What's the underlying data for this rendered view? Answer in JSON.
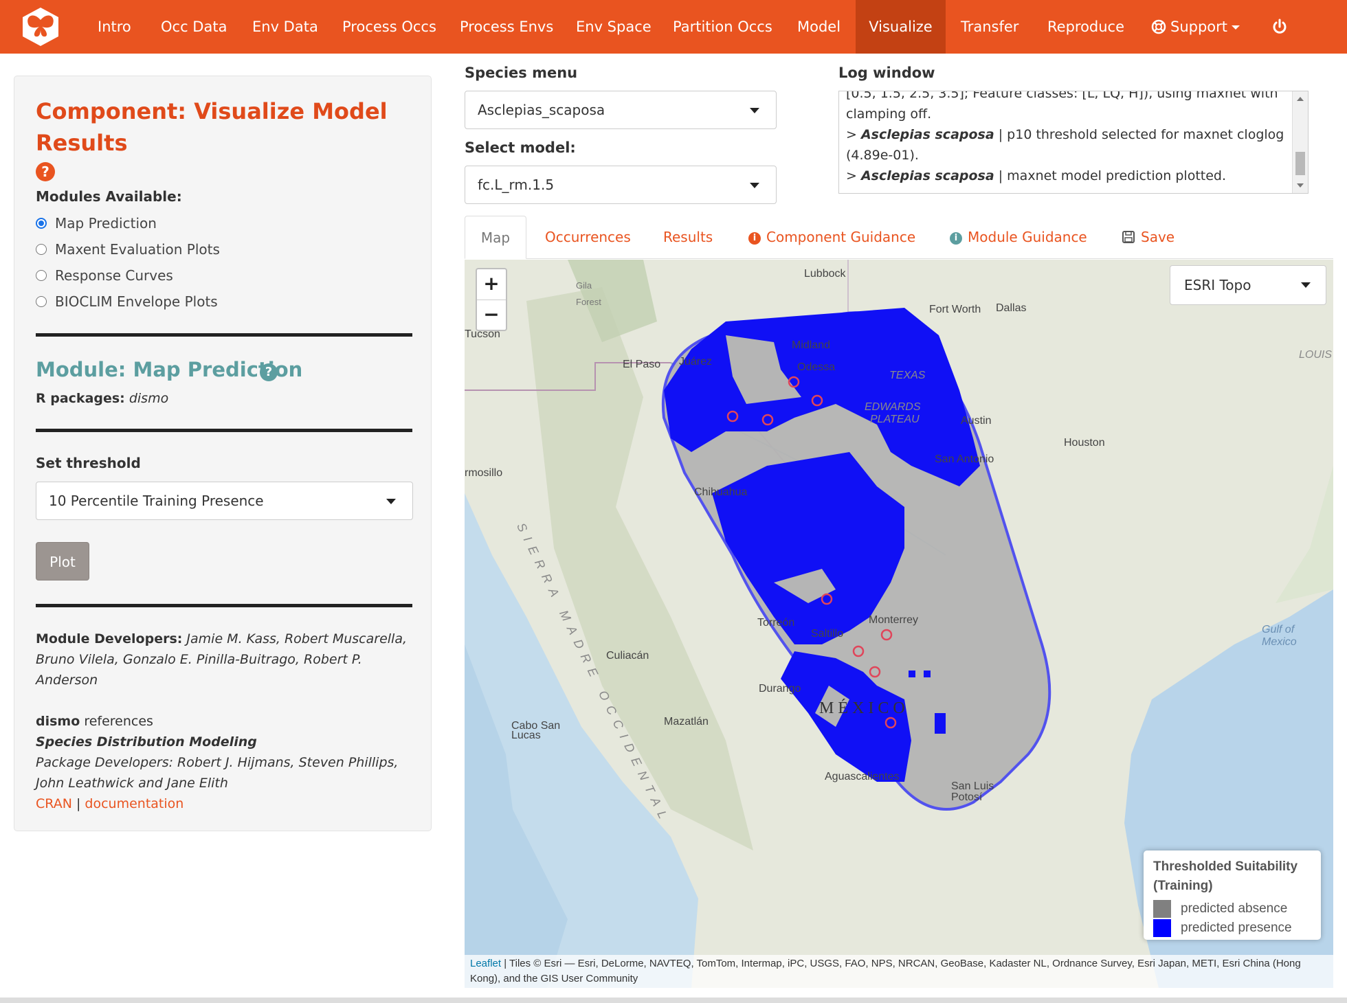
{
  "navbar": {
    "items": [
      "Intro",
      "Occ Data",
      "Env Data",
      "Process Occs",
      "Process Envs",
      "Env Space",
      "Partition Occs",
      "Model",
      "Visualize",
      "Transfer",
      "Reproduce"
    ],
    "support_label": "Support",
    "active": "Visualize",
    "power_icon": "power-icon",
    "logo_icon": "butterfly-logo-icon",
    "accent_color": "#e95420"
  },
  "sidebar": {
    "component_title": "Component: Visualize Model Results",
    "modules_label": "Modules Available:",
    "modules": [
      {
        "label": "Map Prediction",
        "selected": true
      },
      {
        "label": "Maxent Evaluation Plots",
        "selected": false
      },
      {
        "label": "Response Curves",
        "selected": false
      },
      {
        "label": "BIOCLIM Envelope Plots",
        "selected": false
      }
    ],
    "module_title": "Module: Map Prediction",
    "rpackages_label": "R packages:",
    "rpackages_value": "dismo",
    "threshold_label": "Set threshold",
    "threshold_value": "10 Percentile Training Presence",
    "plot_button": "Plot",
    "developers_label": "Module Developers:",
    "developers": "Jamie M. Kass, Robert Muscarella, Bruno Vilela, Gonzalo E. Pinilla-Buitrago, Robert P. Anderson",
    "ref_pkg": "dismo",
    "ref_word": "references",
    "ref_title": "Species Distribution Modeling",
    "ref_devs": "Package Developers: Robert J. Hijmans, Steven Phillips, John Leathwick and Jane Elith",
    "cran": "CRAN",
    "sep": "|",
    "documentation": "documentation"
  },
  "top": {
    "species_label": "Species menu",
    "species_value": "Asclepias_scaposa",
    "model_label": "Select model:",
    "model_value": "fc.L_rm.1.5",
    "log_label": "Log window",
    "log_lines": [
      {
        "text": "[0.5, 1.5, 2.5, 3.5]; Feature classes: [L, LQ, H]), using maxnet with"
      },
      {
        "text": "clamping off."
      },
      {
        "prefix": "> ",
        "species": "Asclepias scaposa",
        "rest": " | p10 threshold selected for maxnet cloglog"
      },
      {
        "text": "(4.89e-01)."
      },
      {
        "prefix": "> ",
        "species": "Asclepias scaposa",
        "rest": " | maxnet model prediction plotted."
      }
    ]
  },
  "tabs": {
    "map": "Map",
    "occurrences": "Occurrences",
    "results": "Results",
    "component_guidance": "Component Guidance",
    "module_guidance": "Module Guidance",
    "save": "Save"
  },
  "map": {
    "zoom_in": "+",
    "zoom_out": "−",
    "basemap": "ESRI Topo",
    "legend_title": "Thresholded Suitability (Training)",
    "legend_absence": "predicted absence",
    "legend_presence": "predicted presence",
    "absence_color": "#808080",
    "presence_color": "#0000ff",
    "attribution_link": "Leaflet",
    "attribution": "| Tiles © Esri — Esri, DeLorme, NAVTEQ, TomTom, Intermap, iPC, USGS, FAO, NPS, NRCAN, GeoBase, Kadaster NL, Ordnance Survey, Esri Japan, METI, Esri China (Hong Kong), and the GIS User Community",
    "places": {
      "lubbock": "Lubbock",
      "fort_worth": "Fort Worth",
      "dallas": "Dallas",
      "midland": "Midland",
      "odessa": "Odessa",
      "texas": "TEXAS",
      "edwards": "EDWARDS",
      "plateau": "PLATEAU",
      "austin": "Austin",
      "houston": "Houston",
      "san_antonio": "San Antonio",
      "el_paso": "El Paso",
      "juarez": "Juárez",
      "tucson": "Tucson",
      "hermosillo": "rmosillo",
      "chihuahua": "Chihuahua",
      "monterrey": "Monterrey",
      "saltillo": "Saltillo",
      "torreon": "Torreón",
      "culiacan": "Culiacán",
      "durango": "Durango",
      "mexico": "MÉXICO",
      "mazatlan": "Mazatlán",
      "cabo": "Cabo San",
      "lucas": "Lucas",
      "aguascalientes": "Aguascalientes",
      "san_luis": "San Luis",
      "potosi": "Potosí",
      "gulf1": "Gulf of",
      "gulf2": "Mexico",
      "louis": "LOUIS",
      "gila": "Gila",
      "forest": "Forest",
      "sierra_madre": "SIERRA MADRE OCCIDENTAL"
    }
  }
}
